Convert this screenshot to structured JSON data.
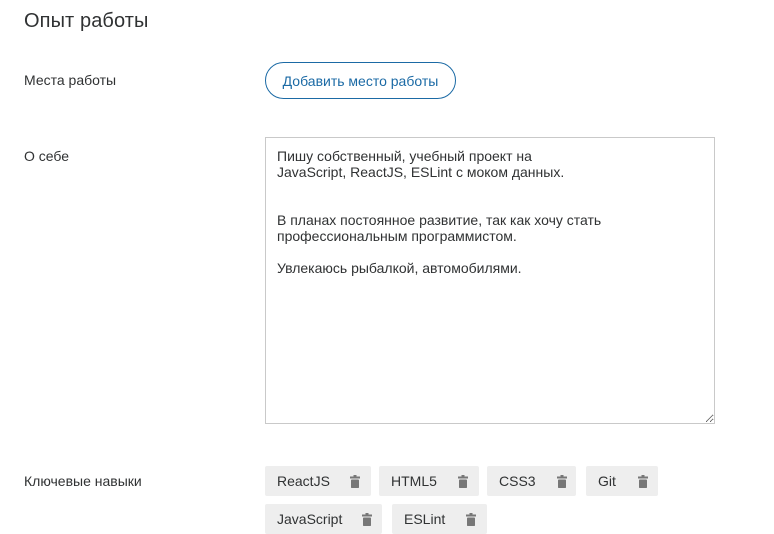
{
  "section": {
    "title": "Опыт работы"
  },
  "workplaces": {
    "label": "Места работы",
    "add_button_label": "Добавить место работы"
  },
  "about": {
    "label": "О себе",
    "value": "Пишу собственный, учебный проект на\nJavaScript, ReactJS, ESLint с моком данных.\n\n\nВ планах постоянное развитие, так как хочу стать\nпрофессиональным программистом.\n\nУвлекаюсь рыбалкой, автомобилями."
  },
  "skills": {
    "label": "Ключевые навыки",
    "delete_icon": "trash-icon",
    "items": [
      {
        "label": "ReactJS"
      },
      {
        "label": "HTML5"
      },
      {
        "label": "CSS3"
      },
      {
        "label": "Git"
      },
      {
        "label": "JavaScript"
      },
      {
        "label": "ESLint"
      }
    ]
  },
  "colors": {
    "accent": "#1b6aa5",
    "text": "#303233",
    "chip_background": "#eeeeee",
    "border": "#c9c9c9",
    "icon": "#777777"
  }
}
